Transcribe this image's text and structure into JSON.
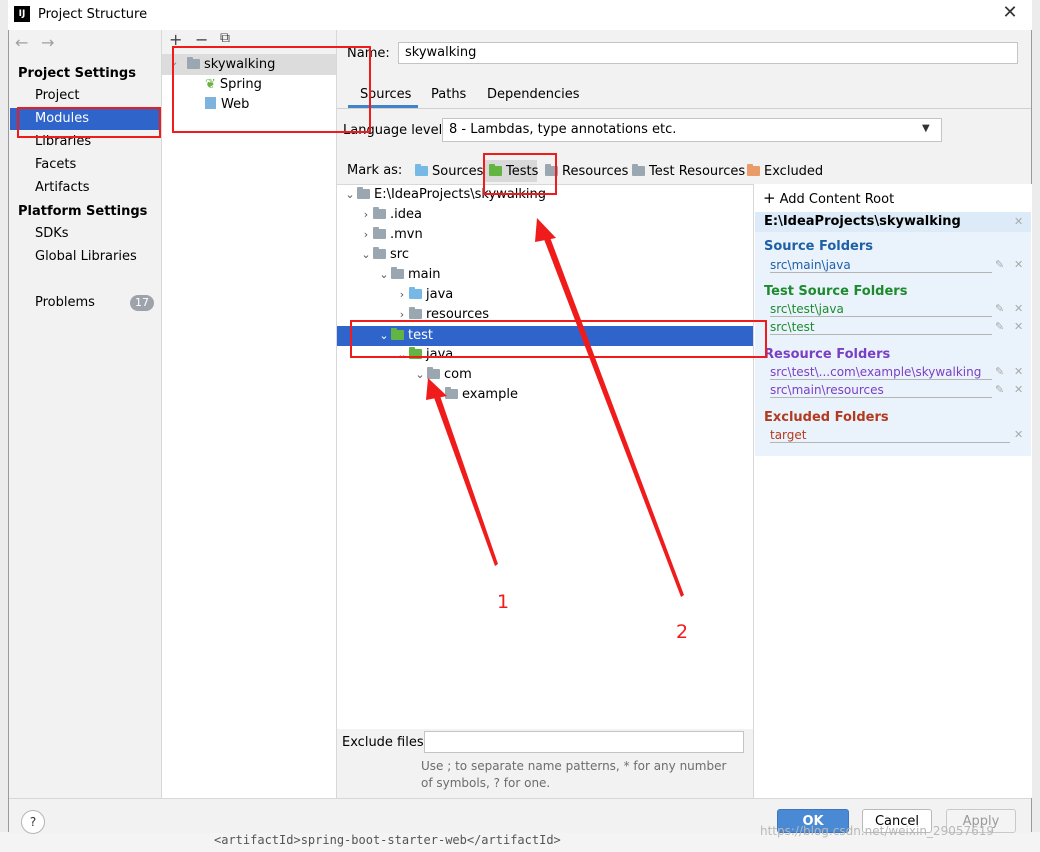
{
  "window": {
    "title": "Project Structure",
    "app_icon_text": "IJ"
  },
  "nav": {
    "back": "←",
    "forward": "→",
    "project_settings": "Project Settings",
    "project_items": [
      {
        "label": "Project",
        "selected": false
      },
      {
        "label": "Modules",
        "selected": true
      },
      {
        "label": "Libraries",
        "selected": false
      },
      {
        "label": "Facets",
        "selected": false
      },
      {
        "label": "Artifacts",
        "selected": false
      }
    ],
    "platform_settings": "Platform Settings",
    "platform_items": [
      {
        "label": "SDKs"
      },
      {
        "label": "Global Libraries"
      }
    ],
    "problems": "Problems",
    "problems_count": "17"
  },
  "modules": {
    "toolbar": {
      "add": "+",
      "remove": "−",
      "copy": "⧉"
    },
    "tree": [
      {
        "label": "skywalking",
        "icon": "module-folder-icon",
        "level": 0,
        "expanded": true
      },
      {
        "label": "Spring",
        "icon": "spring-leaf-icon",
        "level": 1
      },
      {
        "label": "Web",
        "icon": "web-icon",
        "level": 1
      }
    ]
  },
  "module": {
    "name_label": "Name:",
    "name_value": "skywalking",
    "tabs": [
      {
        "label": "Sources",
        "active": true
      },
      {
        "label": "Paths",
        "active": false
      },
      {
        "label": "Dependencies",
        "active": false
      }
    ],
    "language_level_label": "Language level:",
    "language_level_value": "8 - Lambdas, type annotations etc.",
    "mark_as_label": "Mark as:",
    "mark_as": [
      {
        "label": "Sources",
        "color": "#76b8e6"
      },
      {
        "label": "Tests",
        "color": "#62b543"
      },
      {
        "label": "Resources",
        "color": "#9aa7b0"
      },
      {
        "label": "Test Resources",
        "color": "#9aa7b0"
      },
      {
        "label": "Excluded",
        "color": "#e99c67"
      }
    ]
  },
  "source_tree": [
    {
      "label": "E:\\IdeaProjects\\skywalking",
      "depth": 0,
      "chevron": "down",
      "folder": "gray"
    },
    {
      "label": ".idea",
      "depth": 1,
      "chevron": "right",
      "folder": "gray"
    },
    {
      "label": ".mvn",
      "depth": 1,
      "chevron": "right",
      "folder": "gray"
    },
    {
      "label": "src",
      "depth": 1,
      "chevron": "down",
      "folder": "gray"
    },
    {
      "label": "main",
      "depth": 2,
      "chevron": "down",
      "folder": "gray"
    },
    {
      "label": "java",
      "depth": 3,
      "chevron": "right",
      "folder": "blue"
    },
    {
      "label": "resources",
      "depth": 3,
      "chevron": "right",
      "folder": "res"
    },
    {
      "label": "test",
      "depth": 2,
      "chevron": "down",
      "folder": "green",
      "selected": true
    },
    {
      "label": "java",
      "depth": 3,
      "chevron": "down",
      "folder": "green"
    },
    {
      "label": "com",
      "depth": 4,
      "chevron": "down",
      "folder": "gray"
    },
    {
      "label": "example",
      "depth": 5,
      "chevron": "",
      "folder": "gray"
    }
  ],
  "content_root": {
    "add_label": "Add Content Root",
    "add_icon": "+",
    "root_path": "E:\\IdeaProjects\\skywalking",
    "sections": [
      {
        "title": "Source Folders",
        "color": "#1f5fa6",
        "paths": [
          "src\\main\\java"
        ]
      },
      {
        "title": "Test Source Folders",
        "color": "#1e8a2e",
        "paths": [
          "src\\test\\java",
          "src\\test"
        ]
      },
      {
        "title": "Resource Folders",
        "color": "#7b3fc4",
        "paths": [
          "src\\test\\...com\\example\\skywalking",
          "src\\main\\resources"
        ]
      },
      {
        "title": "Excluded Folders",
        "color": "#b33a1e",
        "paths": [
          "target"
        ]
      }
    ]
  },
  "exclude": {
    "label": "Exclude files:",
    "value": "",
    "hint": "Use ; to separate name patterns, * for any number of symbols, ? for one."
  },
  "buttons": {
    "help": "?",
    "ok": "OK",
    "cancel": "Cancel",
    "apply": "Apply"
  },
  "annotations": {
    "one": "1",
    "two": "2"
  },
  "backdrop_code": "<artifactId>spring-boot-starter-web</artifactId>",
  "watermark": "https://blog.csdn.net/weixin_29057619"
}
